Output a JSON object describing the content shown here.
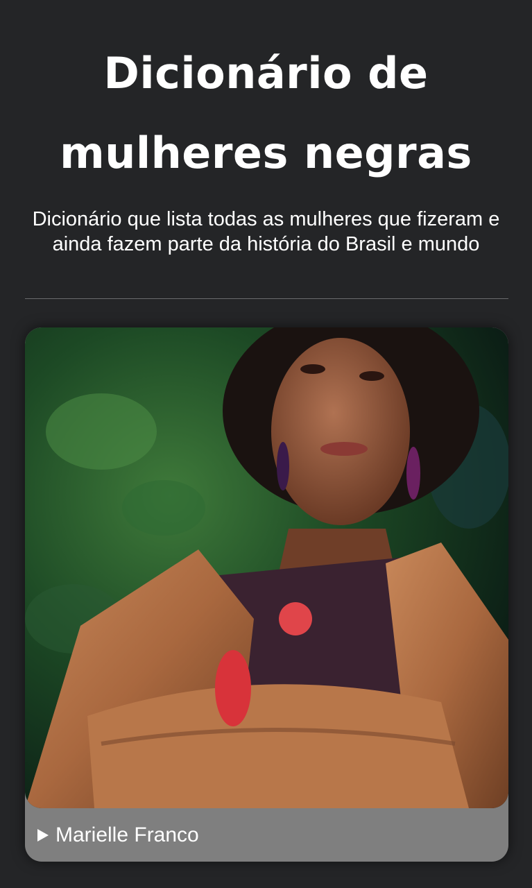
{
  "header": {
    "title_line1": "Dicionário de",
    "title_line2": "mulheres negras",
    "subtitle": "Dicionário que lista todas as mulheres que fizeram e ainda fazem parte da história do Brasil e mundo"
  },
  "cards": [
    {
      "name": "Marielle Franco",
      "image_icon": "portrait-photo",
      "toggle_icon": "play-triangle-icon"
    }
  ],
  "colors": {
    "background": "#242527",
    "card_footer": "#7f7f7f",
    "text": "#ffffff"
  }
}
